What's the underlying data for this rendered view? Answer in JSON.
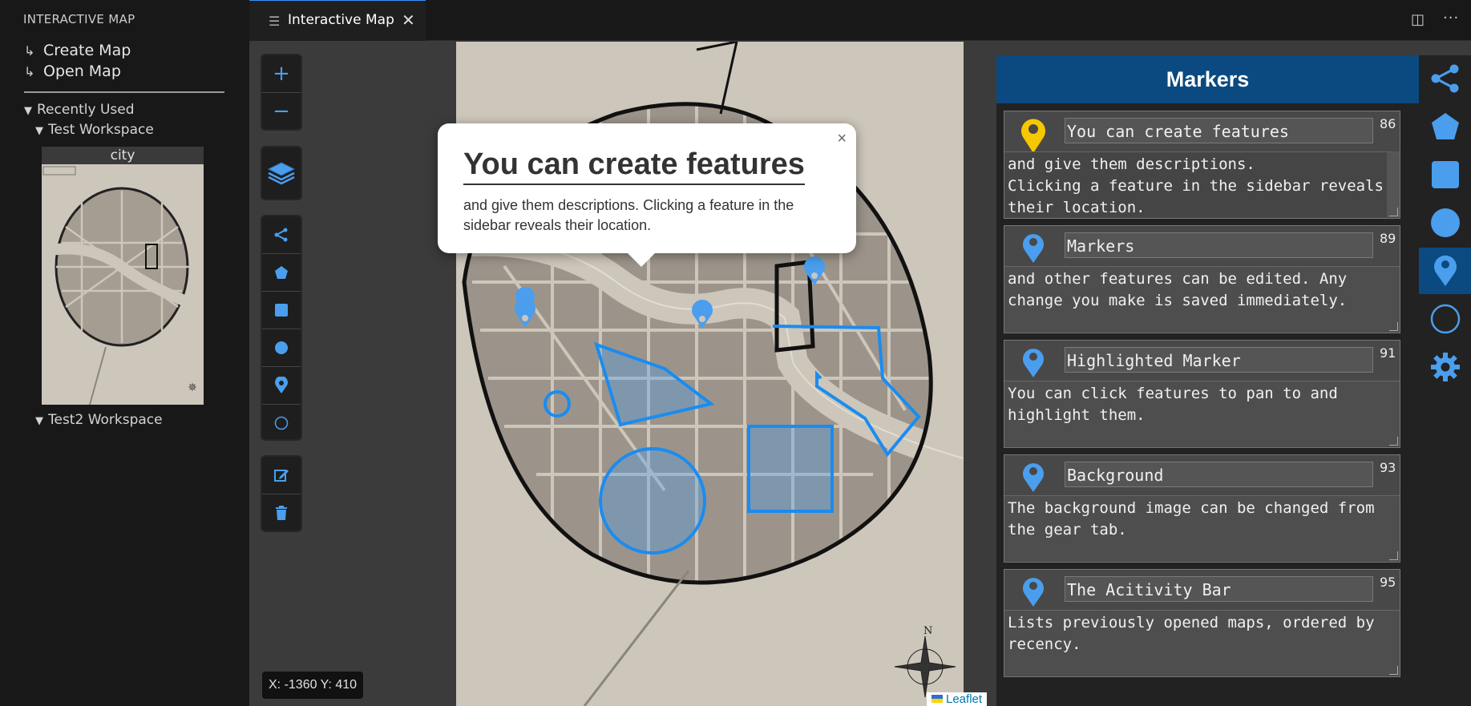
{
  "sidebar": {
    "title": "INTERACTIVE MAP",
    "actions": [
      {
        "label": "Create Map"
      },
      {
        "label": "Open Map"
      }
    ],
    "recent_label": "Recently Used",
    "workspaces": [
      {
        "label": "Test Workspace"
      },
      {
        "label": "Test2 Workspace"
      }
    ],
    "map_thumb_title": "city"
  },
  "tab": {
    "label": "Interactive Map"
  },
  "map": {
    "coords": "X: -1360 Y: 410",
    "attribution": "Leaflet",
    "compass": "N",
    "popup": {
      "title": "You can create features",
      "body": "and give them descriptions. Clicking a feature in the sidebar reveals their location."
    }
  },
  "panel": {
    "title": "Markers",
    "cards": [
      {
        "title": "You can create features",
        "num": "86",
        "desc": "and give them descriptions.\nClicking a feature in the sidebar reveals their location.",
        "pin_color": "#f6c800"
      },
      {
        "title": "Markers",
        "num": "89",
        "desc": "and other features can be edited. Any change you make is saved immediately.",
        "pin_color": "#4a9eed"
      },
      {
        "title": "Highlighted Marker",
        "num": "91",
        "desc": "You can click features to pan to and highlight them.",
        "pin_color": "#4a9eed"
      },
      {
        "title": "Background",
        "num": "93",
        "desc": "The background image can be changed from the gear tab.",
        "pin_color": "#4a9eed"
      },
      {
        "title": "The Acitivity Bar",
        "num": "95",
        "desc": "Lists previously opened maps, ordered by recency.",
        "pin_color": "#4a9eed"
      }
    ]
  },
  "colors": {
    "accent": "#4a9eed",
    "active_header": "#0a4a80",
    "highlight_pin": "#f6c800"
  }
}
